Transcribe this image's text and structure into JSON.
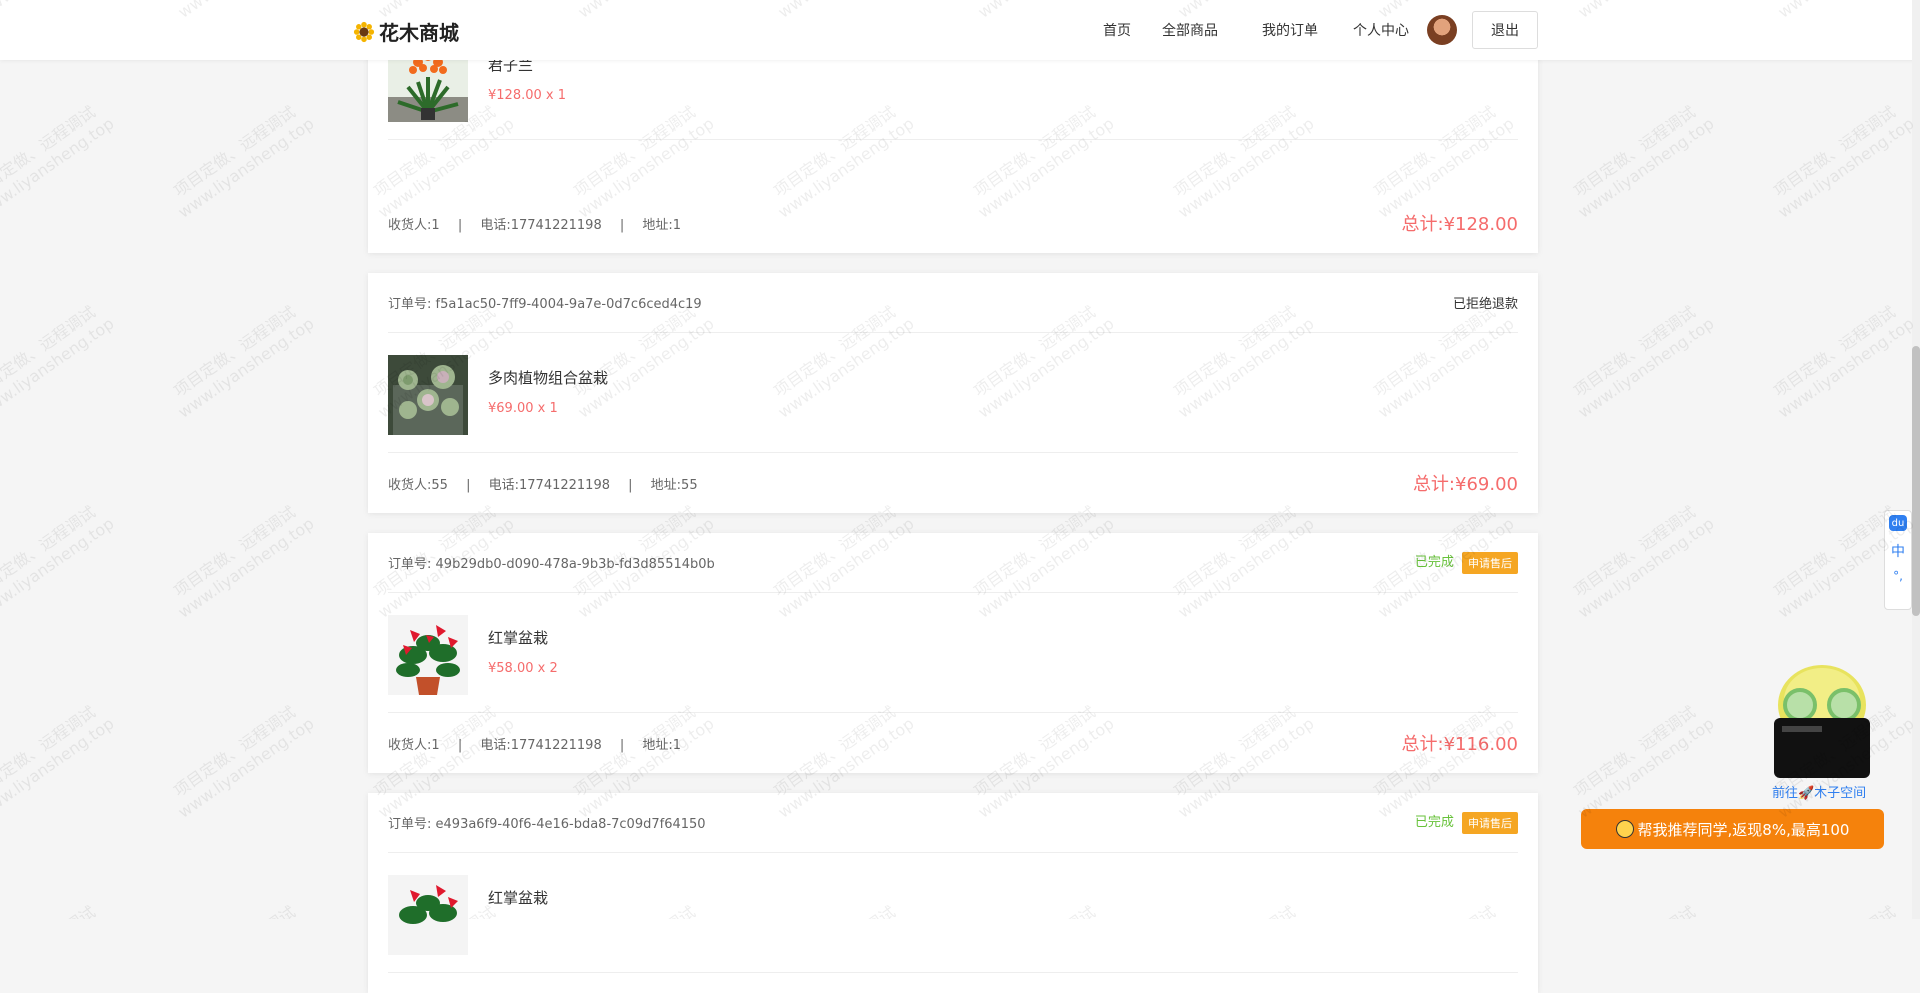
{
  "header": {
    "logo_text": "花木商城",
    "nav": {
      "home": "首页",
      "all_products": "全部商品",
      "my_orders": "我的订单",
      "profile": "个人中心"
    },
    "logout": "退出"
  },
  "labels": {
    "order_no": "订单号:",
    "receiver": "收货人:",
    "phone": "电话:",
    "address": "地址:",
    "total": "总计:",
    "separator": "|",
    "after_sale": "申请售后"
  },
  "orders": [
    {
      "order_no": "",
      "status": "",
      "product_name": "君子兰",
      "price": "¥128.00",
      "quantity": "x 1",
      "receiver": "1",
      "phone": "17741221198",
      "address": "1",
      "total": "¥128.00"
    },
    {
      "order_no": "f5a1ac50-7ff9-4004-9a7e-0d7c6ced4c19",
      "status": "已拒绝退款",
      "product_name": "多肉植物组合盆栽",
      "price": "¥69.00",
      "quantity": "x 1",
      "receiver": "55",
      "phone": "17741221198",
      "address": "55",
      "total": "¥69.00"
    },
    {
      "order_no": "49b29db0-d090-478a-9b3b-fd3d85514b0b",
      "status": "已完成",
      "product_name": "红掌盆栽",
      "price": "¥58.00",
      "quantity": "x 2",
      "receiver": "1",
      "phone": "17741221198",
      "address": "1",
      "total": "¥116.00"
    },
    {
      "order_no": "e493a6f9-40f6-4e16-bda8-7c09d7f64150",
      "status": "已完成",
      "product_name": "红掌盆栽",
      "price": "",
      "quantity": "",
      "receiver": "",
      "phone": "",
      "address": "",
      "total": ""
    }
  ],
  "watermark": {
    "line1": "项目定做、远程调试",
    "line2": "www.liyansheng.top"
  },
  "side_widgets": {
    "ime_logo": "du",
    "ime_lang": "中",
    "ime_punct": "°,",
    "mascot_link": "前往🚀木子空间",
    "promo": "帮我推荐同学,返现8%,最高100"
  },
  "colors": {
    "price_red": "#f56c6c",
    "status_done_green": "#67c23a",
    "after_sale_orange": "#f5a623",
    "promo_orange": "#f5820c",
    "link_blue": "#2f7ff0"
  }
}
